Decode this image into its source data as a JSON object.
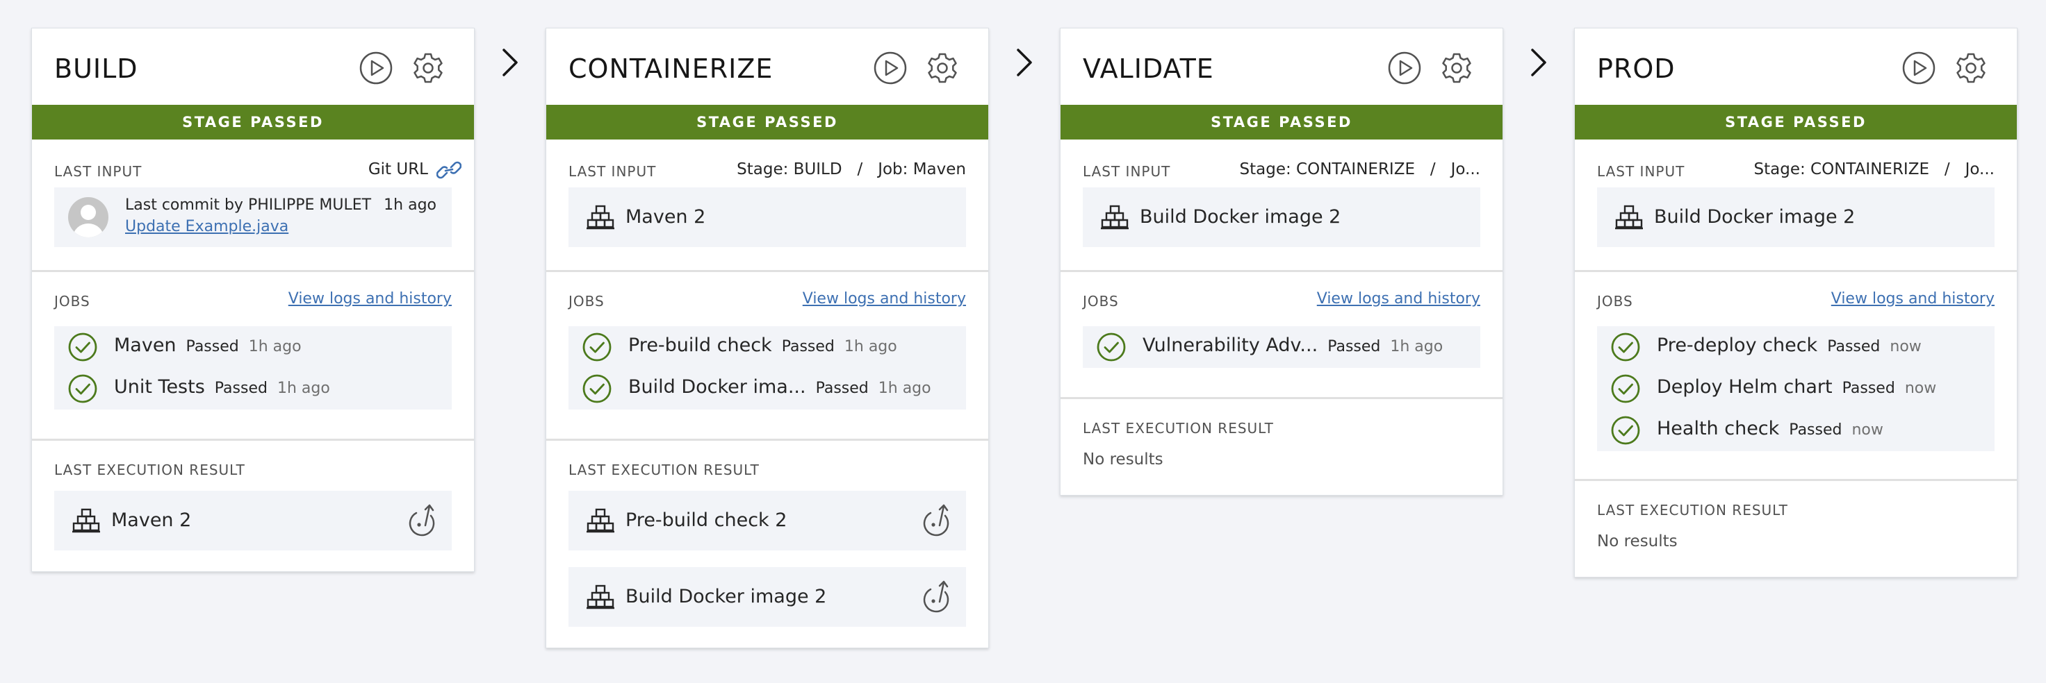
{
  "stages": [
    {
      "title": "BUILD",
      "status": "STAGE PASSED",
      "last_input": {
        "label": "LAST INPUT",
        "source": "Git URL",
        "commit_text": "Last commit by PHILIPPE MULET",
        "commit_time": "1h ago",
        "commit_link": "Update Example.java"
      },
      "jobs": {
        "label": "JOBS",
        "view_logs": "View logs and history",
        "items": [
          {
            "name": "Maven",
            "status": "Passed",
            "time": "1h ago"
          },
          {
            "name": "Unit Tests",
            "status": "Passed",
            "time": "1h ago"
          }
        ]
      },
      "result": {
        "label": "LAST EXECUTION RESULT",
        "items": [
          {
            "name": "Maven 2"
          }
        ]
      }
    },
    {
      "title": "CONTAINERIZE",
      "status": "STAGE PASSED",
      "last_input": {
        "label": "LAST INPUT",
        "source": "Stage: BUILD   /   Job: Maven",
        "input_name": "Maven 2"
      },
      "jobs": {
        "label": "JOBS",
        "view_logs": "View logs and history",
        "items": [
          {
            "name": "Pre-build check",
            "status": "Passed",
            "time": "1h ago"
          },
          {
            "name": "Build Docker ima...",
            "status": "Passed",
            "time": "1h ago"
          }
        ]
      },
      "result": {
        "label": "LAST EXECUTION RESULT",
        "items": [
          {
            "name": "Pre-build check 2"
          },
          {
            "name": "Build Docker image 2"
          }
        ]
      }
    },
    {
      "title": "VALIDATE",
      "status": "STAGE PASSED",
      "last_input": {
        "label": "LAST INPUT",
        "source": "Stage: CONTAINERIZE   /   Jo...",
        "input_name": "Build Docker image 2"
      },
      "jobs": {
        "label": "JOBS",
        "view_logs": "View logs and history",
        "items": [
          {
            "name": "Vulnerability Adv...",
            "status": "Passed",
            "time": "1h ago"
          }
        ]
      },
      "result": {
        "label": "LAST EXECUTION RESULT",
        "no_results": "No results"
      }
    },
    {
      "title": "PROD",
      "status": "STAGE PASSED",
      "last_input": {
        "label": "LAST INPUT",
        "source": "Stage: CONTAINERIZE   /   Jo...",
        "input_name": "Build Docker image 2"
      },
      "jobs": {
        "label": "JOBS",
        "view_logs": "View logs and history",
        "items": [
          {
            "name": "Pre-deploy check",
            "status": "Passed",
            "time": "now"
          },
          {
            "name": "Deploy Helm chart",
            "status": "Passed",
            "time": "now"
          },
          {
            "name": "Health check",
            "status": "Passed",
            "time": "now"
          }
        ]
      },
      "result": {
        "label": "LAST EXECUTION RESULT",
        "no_results": "No results"
      }
    }
  ],
  "icons": {
    "play": "play-circle-icon",
    "settings": "gear-icon",
    "link": "link-icon",
    "package": "package-icon",
    "check": "checkmark-circle-icon",
    "rerun": "rerun-icon",
    "chevron": "chevron-right-icon"
  },
  "colors": {
    "passed_banner": "#5a8320",
    "check": "#4c7a1c",
    "link": "#3d70b2",
    "background": "#f3f4f8"
  }
}
